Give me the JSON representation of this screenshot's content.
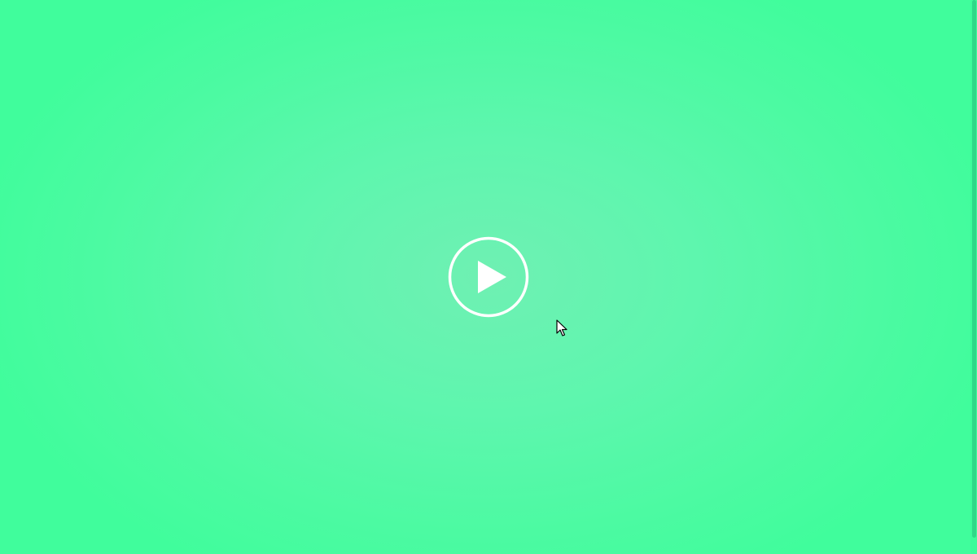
{
  "player": {
    "play_icon": "play-circle-icon",
    "pointer_icon": "mouse-pointer-icon"
  },
  "colors": {
    "background_center": "#6ff0b3",
    "background_edge": "#40fd9c",
    "icon": "#ffffff",
    "scrollbar_thumb": "#2fd888"
  }
}
